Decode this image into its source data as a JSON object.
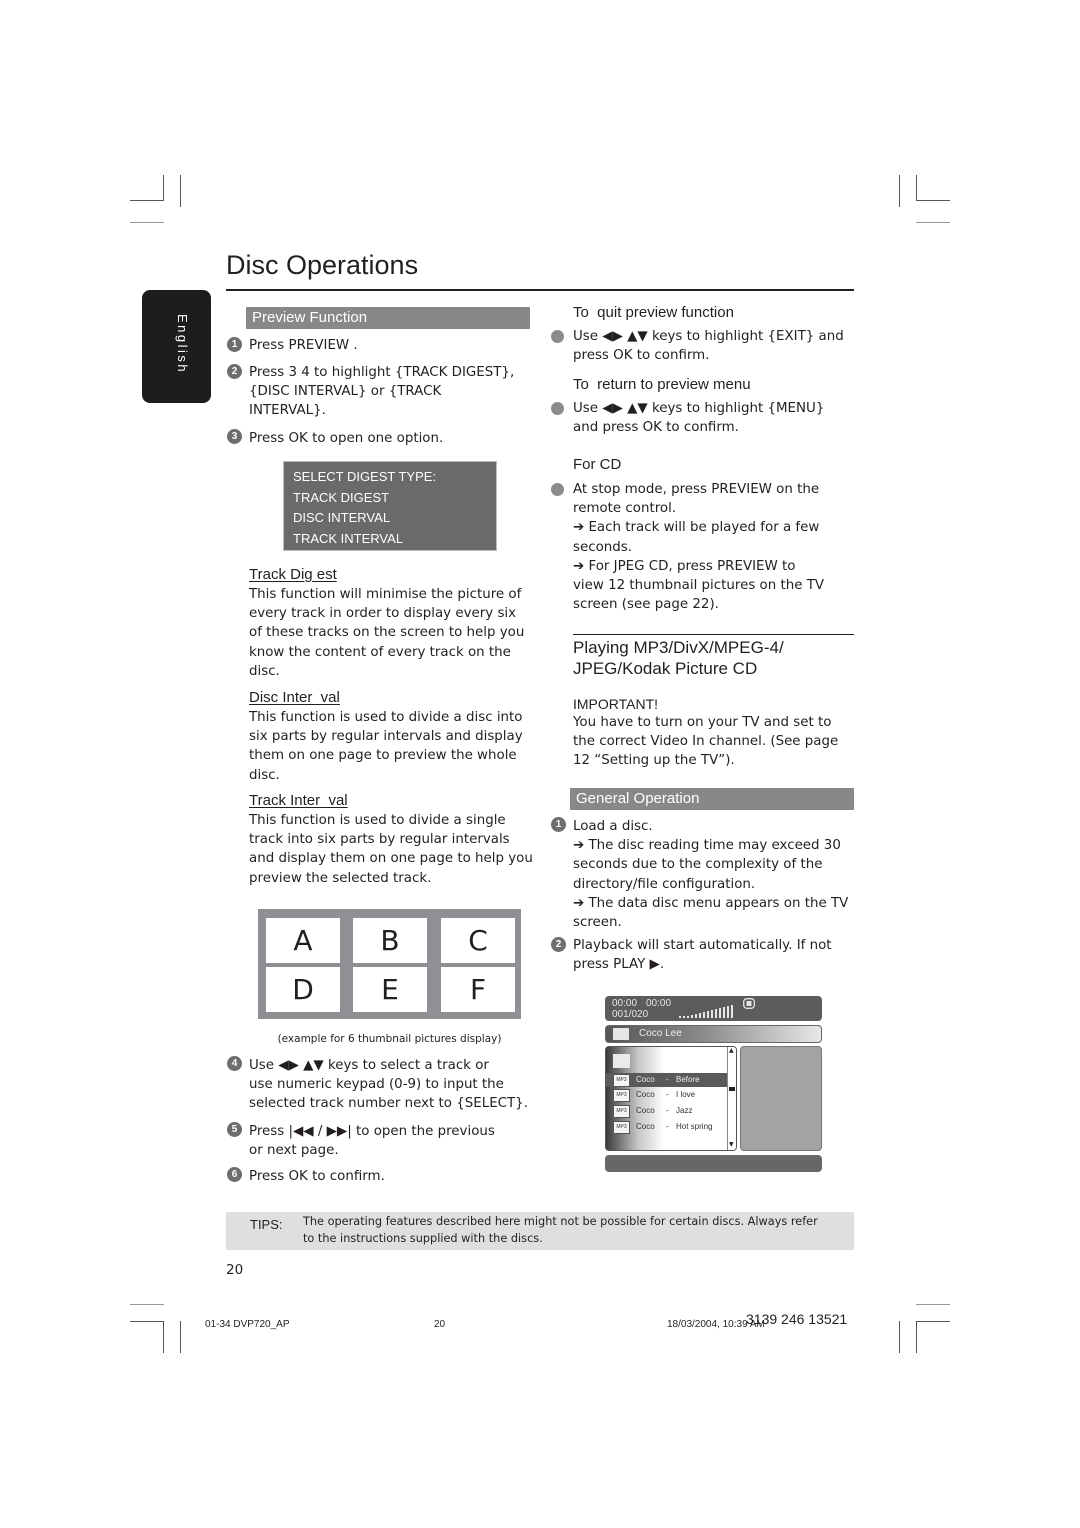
{
  "page": {
    "title": "Disc Operations",
    "language_tab": "English",
    "page_number": "20"
  },
  "preview_function": {
    "heading": "Preview Function",
    "steps": [
      {
        "num": "1",
        "text": "Press PREVIEW ."
      },
      {
        "num": "2",
        "line1": "Press 3 4   to highlight {TRACK DIGEST},",
        "line2": "{DISC INTERVAL} or {TRACK",
        "line3": "INTERVAL}."
      },
      {
        "num": "3",
        "text": "Press OK  to open one option."
      }
    ],
    "menu": {
      "items": [
        "SELECT DIGEST TYPE:",
        "TRACK DIGEST",
        "DISC INTERVAL",
        "TRACK INTERVAL"
      ]
    },
    "track_digest": {
      "heading": "Track Dig est",
      "lines": [
        "This function will minimise the picture of",
        "every track in order to display every six",
        "of these tracks on the screen to help you",
        "know the content of every track on the",
        "disc."
      ]
    },
    "disc_interval": {
      "heading": "Disc Inter  val",
      "lines": [
        "This function is used to divide a disc into",
        "six parts by regular intervals and display",
        "them on one page to preview the whole",
        "disc."
      ]
    },
    "track_interval": {
      "heading": "Track Inter  val",
      "lines": [
        "This function is used to divide a single",
        "track into six parts by regular intervals",
        "and display them on one page to help you",
        "preview the selected track."
      ]
    },
    "thumbnails": {
      "labels": [
        "A",
        "B",
        "C",
        "D",
        "E",
        "F"
      ],
      "caption": "(example for 6 thumbnail pictures display)"
    },
    "steps_after": [
      {
        "num": "4",
        "line1": "Use ◀▶ ▲▼ keys to select a track or",
        "line2": "use numeric keypad (0-9)   to input the",
        "line3": "selected track number next to {SELECT}."
      },
      {
        "num": "5",
        "line1": "Press |◀◀ / ▶▶| to open the previous",
        "line2": "or next page."
      },
      {
        "num": "6",
        "text": "Press OK  to confirm."
      }
    ]
  },
  "quit_preview": {
    "heading": "To  quit preview function",
    "lines": [
      "Use ◀▶ ▲▼ keys to highlight {EXIT} and",
      "press OK  to confirm."
    ]
  },
  "return_preview": {
    "heading": "To  return to preview menu",
    "lines": [
      "Use ◀▶ ▲▼ keys to highlight {MENU}",
      "and press OK  to confirm."
    ]
  },
  "for_cd": {
    "heading": "For CD",
    "lines": [
      "At stop mode, press PREVIEW  on the",
      "remote control.",
      "➔ Each track will be played for a few",
      "seconds.",
      "➔ For JPEG CD, press PREVIEW  to",
      "view 12 thumbnail pictures on the TV",
      "screen (see page 22)."
    ]
  },
  "playing_mp3": {
    "heading_line1": "Playing MP3/DivX/MPEG-4/",
    "heading_line2": "JPEG/Kodak Picture CD",
    "important_label": "IMPORTANT!",
    "important_lines": [
      "You have to turn on your TV and set to",
      "the correct Video In channel.  (See page",
      "12 “Setting up the TV”)."
    ]
  },
  "general_operation": {
    "heading": "General Operation",
    "step1": {
      "num": "1",
      "lines": [
        "Load a disc.",
        "➔ The disc reading time may exceed 30",
        "seconds due to the complexity of the",
        "directory/file configuration.",
        "➔ The data disc menu appears on the TV",
        "screen."
      ]
    },
    "step2": {
      "num": "2",
      "lines": [
        "Playback will start automatically. If not",
        "press PLAY  ▶."
      ]
    }
  },
  "osd": {
    "time_elapsed": "00:00",
    "time_total": "00:00",
    "track_counter": "001/020",
    "folder_name": "Coco Lee",
    "tracks": [
      {
        "type": "MP3",
        "artist": "Coco",
        "sep": "-",
        "title": "Before",
        "selected": true
      },
      {
        "type": "MP3",
        "artist": "Coco",
        "sep": "-",
        "title": "I love",
        "selected": false
      },
      {
        "type": "MP3",
        "artist": "Coco",
        "sep": "-",
        "title": "Jazz",
        "selected": false
      },
      {
        "type": "MP3",
        "artist": "Coco",
        "sep": "-",
        "title": "Hot spring",
        "selected": false
      }
    ]
  },
  "tips": {
    "label": "TIPS:",
    "line1": "The operating features described here might not be possible for certain discs.  Always refer",
    "line2": "to the instructions supplied with the discs."
  },
  "print_footer": {
    "file": "01-34 DVP720_AP",
    "page": "20",
    "timestamp": "18/03/2004, 10:39 AM",
    "code": "3139 246 13521"
  }
}
